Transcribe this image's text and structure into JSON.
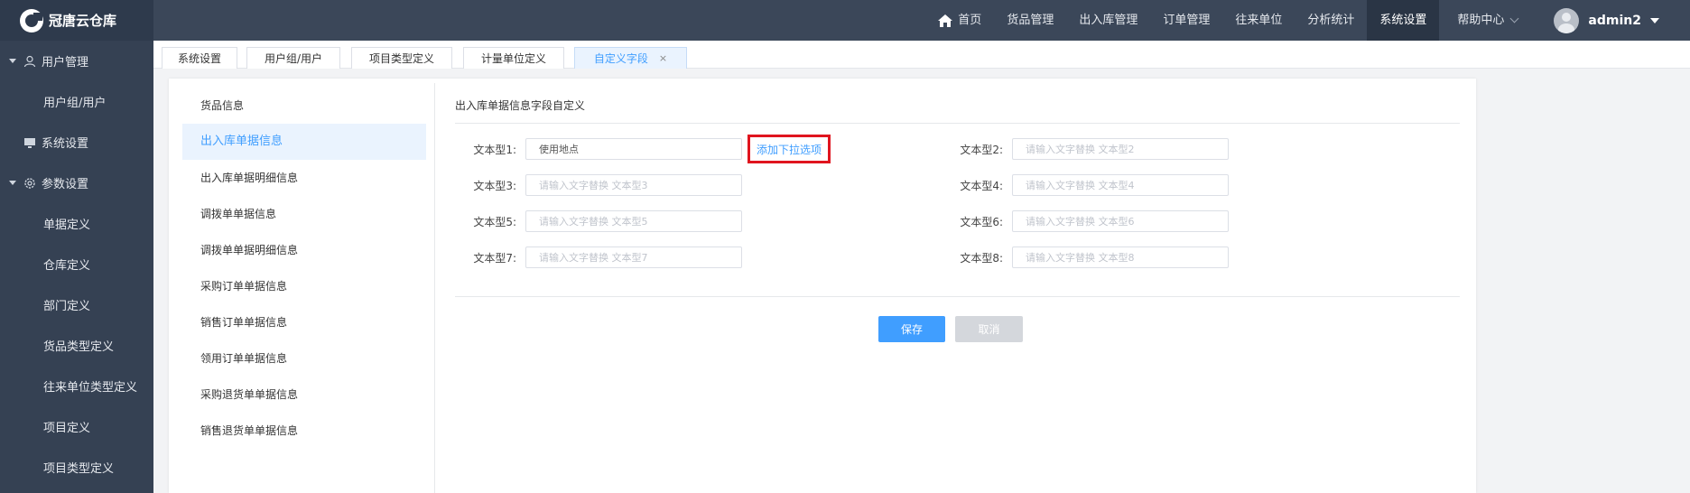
{
  "brand": {
    "name": "冠唐云仓库"
  },
  "topnav": {
    "items": [
      {
        "label": "首页",
        "icon": "home-icon"
      },
      {
        "label": "货品管理"
      },
      {
        "label": "出入库管理"
      },
      {
        "label": "订单管理"
      },
      {
        "label": "往来单位"
      },
      {
        "label": "分析统计"
      },
      {
        "label": "系统设置",
        "active": true
      },
      {
        "label": "帮助中心",
        "icon": "chevron-down-icon"
      }
    ],
    "user": {
      "name": "admin2"
    }
  },
  "sidebar": {
    "items": [
      {
        "label": "用户管理",
        "type": "group",
        "icon": "user-icon"
      },
      {
        "label": "用户组/用户",
        "type": "sub"
      },
      {
        "label": "系统设置",
        "type": "single",
        "icon": "monitor-icon"
      },
      {
        "label": "参数设置",
        "type": "group",
        "icon": "gear-icon"
      },
      {
        "label": "单据定义",
        "type": "sub"
      },
      {
        "label": "仓库定义",
        "type": "sub"
      },
      {
        "label": "部门定义",
        "type": "sub"
      },
      {
        "label": "货品类型定义",
        "type": "sub"
      },
      {
        "label": "往来单位类型定义",
        "type": "sub"
      },
      {
        "label": "项目定义",
        "type": "sub"
      },
      {
        "label": "项目类型定义",
        "type": "sub"
      }
    ]
  },
  "tabs": [
    {
      "label": "系统设置"
    },
    {
      "label": "用户组/用户"
    },
    {
      "label": "项目类型定义"
    },
    {
      "label": "计量单位定义"
    },
    {
      "label": "自定义字段",
      "active": true,
      "close": "×"
    }
  ],
  "menu": {
    "items": [
      {
        "label": "货品信息"
      },
      {
        "label": "出入库单据信息",
        "active": true
      },
      {
        "label": "出入库单据明细信息"
      },
      {
        "label": "调拨单单据信息"
      },
      {
        "label": "调拨单单据明细信息"
      },
      {
        "label": "采购订单单据信息"
      },
      {
        "label": "销售订单单据信息"
      },
      {
        "label": "领用订单单据信息"
      },
      {
        "label": "采购退货单单据信息"
      },
      {
        "label": "销售退货单单据信息"
      }
    ]
  },
  "form": {
    "title": "出入库单据信息字段自定义",
    "fields": [
      {
        "label": "文本型1:",
        "value": "使用地点",
        "placeholder": "请输入文字替换 文本型1"
      },
      {
        "label": "文本型2:",
        "value": "",
        "placeholder": "请输入文字替换 文本型2"
      },
      {
        "label": "文本型3:",
        "value": "",
        "placeholder": "请输入文字替换 文本型3"
      },
      {
        "label": "文本型4:",
        "value": "",
        "placeholder": "请输入文字替换 文本型4"
      },
      {
        "label": "文本型5:",
        "value": "",
        "placeholder": "请输入文字替换 文本型5"
      },
      {
        "label": "文本型6:",
        "value": "",
        "placeholder": "请输入文字替换 文本型6"
      },
      {
        "label": "文本型7:",
        "value": "",
        "placeholder": "请输入文字替换 文本型7"
      },
      {
        "label": "文本型8:",
        "value": "",
        "placeholder": "请输入文字替换 文本型8"
      }
    ],
    "add_option_label": "添加下拉选项",
    "save_label": "保存",
    "cancel_label": "取消"
  },
  "colors": {
    "topbar": "#3b4759",
    "sidebar": "#354153",
    "accent": "#409eff",
    "highlight_border": "#e0141e",
    "cancel_bg": "#d4d7dc"
  }
}
